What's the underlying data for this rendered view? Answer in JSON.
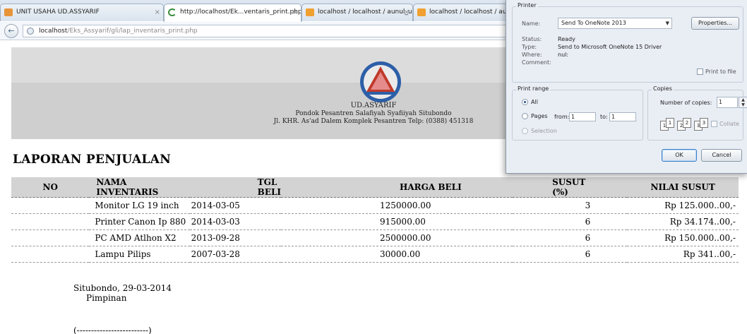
{
  "browser": {
    "tabs": [
      {
        "label": "UNIT USAHA UD.ASSYARIF",
        "close": "×"
      },
      {
        "label": "http://localhost/Ek...ventaris_print.php",
        "close": "×"
      },
      {
        "label": "localhost / localhost / aunul_uin_db /...",
        "close": "×"
      },
      {
        "label": "localhost / localhost / aun",
        "close": ""
      }
    ],
    "back_glyph": "←",
    "url_host": "localhost",
    "url_path": "/Eks_Assyarif/gli/lap_inventaris_print.php"
  },
  "header": {
    "company": "UD.ASYARIF",
    "line2": "Pondok Pesantren Salafiyah Syafiiyah Situbondo",
    "line3": "Jl. KHR. As'ad Dalem Komplek Pesantren Telp: (0388) 451318"
  },
  "report": {
    "title": "LAPORAN PENJUALAN",
    "columns": [
      "NO",
      "NAMA INVENTARIS",
      "TGL BELI",
      "HARGA BELI",
      "SUSUT (%)",
      "NILAI SUSUT"
    ],
    "rows": [
      {
        "no": "",
        "nama": "Monitor LG 19 inch",
        "tgl": "2014-03-05",
        "harga": "1250000.00",
        "susut": "3",
        "nilai": "Rp 125.000..00,-"
      },
      {
        "no": "",
        "nama": "Printer Canon Ip 880",
        "tgl": "2014-03-03",
        "harga": "915000.00",
        "susut": "6",
        "nilai": "Rp 34.174..00,-"
      },
      {
        "no": "",
        "nama": "PC AMD Atlhon X2",
        "tgl": "2013-09-28",
        "harga": "2500000.00",
        "susut": "6",
        "nilai": "Rp 150.000..00,-"
      },
      {
        "no": "",
        "nama": "Lampu Pilips",
        "tgl": "2007-03-28",
        "harga": "30000.00",
        "susut": "6",
        "nilai": "Rp 341..00,-"
      }
    ],
    "footer_place_date": "Situbondo, 29-03-2014",
    "footer_role": "Pimpinan",
    "footer_signature": "(-------------------------)"
  },
  "print_dialog": {
    "printer_group": "Printer",
    "name_label": "Name:",
    "name_value": "Send To OneNote 2013",
    "properties_label": "Properties...",
    "status_label": "Status:",
    "status_value": "Ready",
    "type_label": "Type:",
    "type_value": "Send to Microsoft OneNote 15 Driver",
    "where_label": "Where:",
    "where_value": "nul:",
    "comment_label": "Comment:",
    "print_to_file": "Print to file",
    "range_group": "Print range",
    "all_label": "All",
    "pages_label": "Pages",
    "from_label": "from:",
    "from_value": "1",
    "to_label": "to:",
    "to_value": "1",
    "selection_label": "Selection",
    "copies_group": "Copies",
    "num_copies_label": "Number of copies:",
    "num_copies_value": "1",
    "collate_label": "Collate",
    "ok_label": "OK",
    "cancel_label": "Cancel",
    "accent": "#3b7fc9"
  }
}
